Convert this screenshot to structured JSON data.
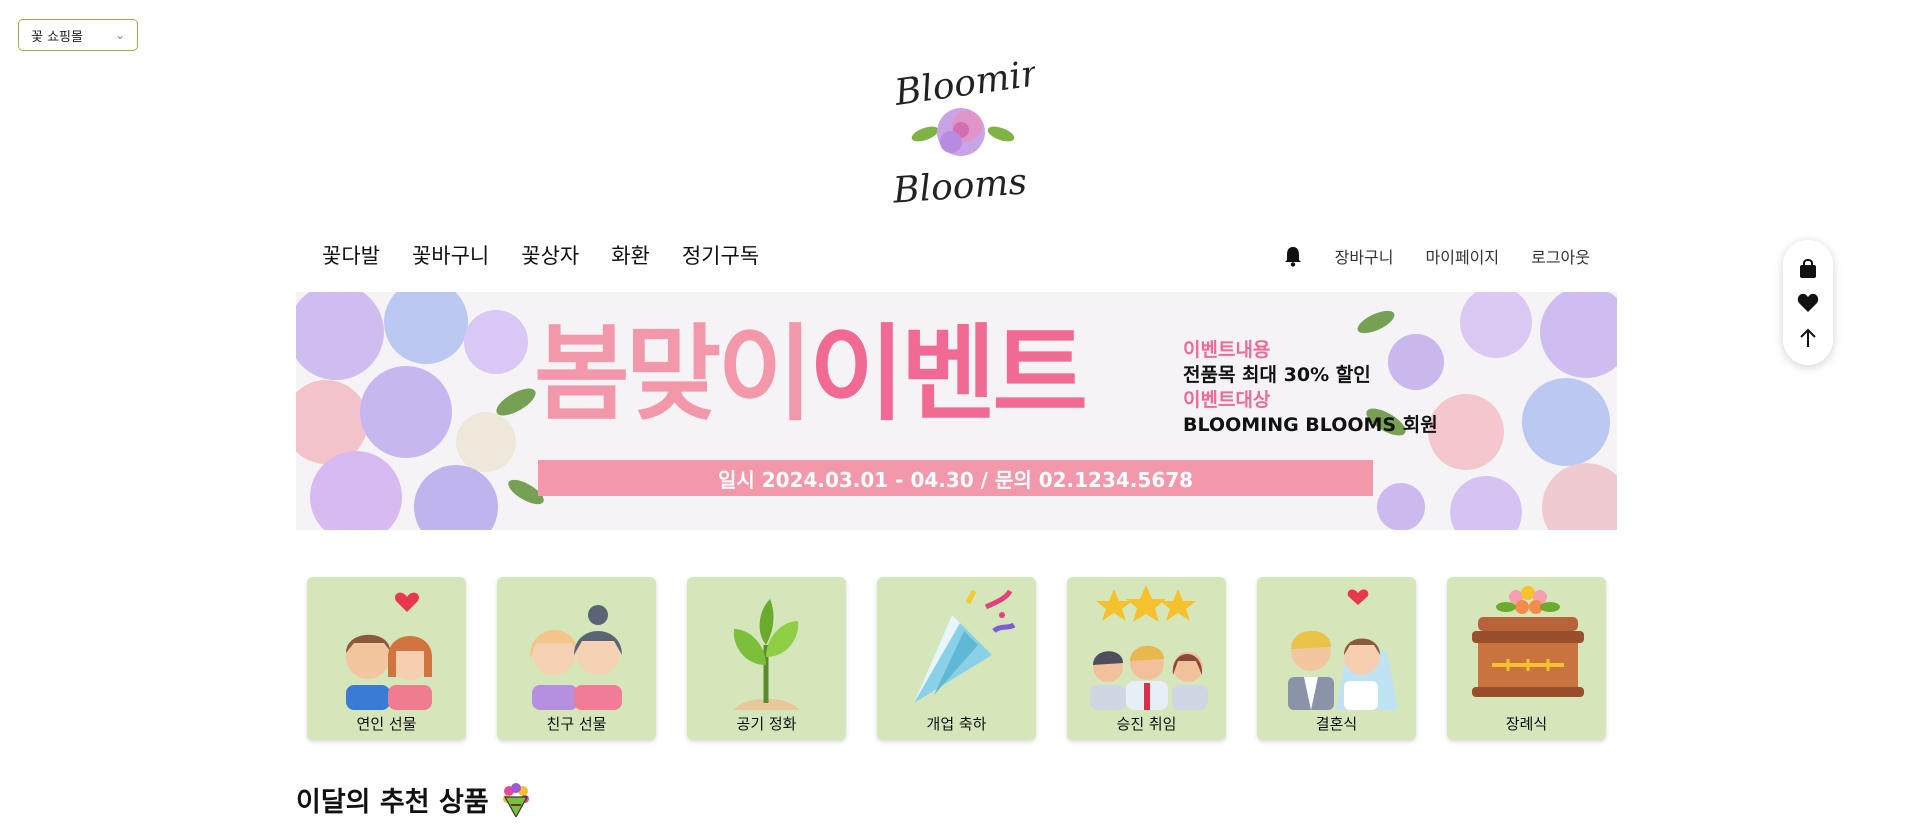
{
  "shop_select": {
    "selected": "꽃 쇼핑몰"
  },
  "logo": {
    "line1": "Blooming",
    "line2": "Blooms"
  },
  "nav": {
    "items": [
      {
        "label": "꽃다발"
      },
      {
        "label": "꽃바구니"
      },
      {
        "label": "꽃상자"
      },
      {
        "label": "화환"
      },
      {
        "label": "정기구독"
      }
    ]
  },
  "util": {
    "cart": "장바구니",
    "mypage": "마이페이지",
    "logout": "로그아웃",
    "bell_icon": "bell-icon"
  },
  "banner": {
    "title_part1": "봄맞이",
    "title_part2": "이벤트",
    "content_label": "이벤트내용",
    "content_value": "전품목 최대 30% 할인",
    "target_label": "이벤트대상",
    "target_value": "BLOOMING BLOOMS 회원",
    "schedule": "일시 2024.03.01 - 04.30 / 문의 02.1234.5678"
  },
  "categories": [
    {
      "label": "연인 선물",
      "icon": "couple-icon"
    },
    {
      "label": "친구 선물",
      "icon": "friends-icon"
    },
    {
      "label": "공기 정화",
      "icon": "plant-icon"
    },
    {
      "label": "개업 축하",
      "icon": "party-popper-icon"
    },
    {
      "label": "승진 취임",
      "icon": "promotion-icon"
    },
    {
      "label": "결혼식",
      "icon": "wedding-icon"
    },
    {
      "label": "장례식",
      "icon": "funeral-icon"
    }
  ],
  "section": {
    "title": "이달의 추천 상품",
    "icon": "bouquet-icon"
  },
  "float_bar": {
    "icons": [
      "shopping-bag-icon",
      "heart-icon",
      "arrow-up-icon"
    ]
  },
  "colors": {
    "accent_green": "#8cbb3f",
    "category_bg": "#d6e6bb",
    "banner_pink": "#f06a94",
    "banner_light_pink": "#f398aa"
  }
}
